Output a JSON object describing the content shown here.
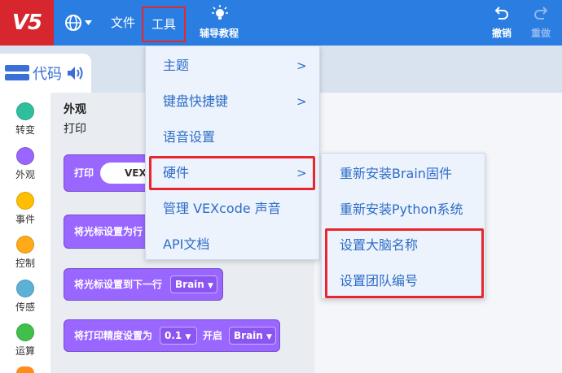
{
  "topbar": {
    "logo": "V5",
    "menu_files": "文件",
    "menu_tools": "工具",
    "tutorial_label": "辅导教程",
    "undo_label": "撤销",
    "redo_label": "重做",
    "bar_color": "#2a7de1",
    "logo_color": "#d7262e"
  },
  "tab": {
    "label": "代码"
  },
  "sidebar": {
    "categories": [
      {
        "label": "转变",
        "color": "#2fbf9f"
      },
      {
        "label": "外观",
        "color": "#9966ff"
      },
      {
        "label": "事件",
        "color": "#ffbf00"
      },
      {
        "label": "控制",
        "color": "#ffab19"
      },
      {
        "label": "传感",
        "color": "#5cb1d6"
      },
      {
        "label": "运算",
        "color": "#40bf4a"
      }
    ]
  },
  "palette": {
    "section_title": "外观",
    "subsection": "打印",
    "block_print": {
      "label": "打印",
      "value": "VEX"
    },
    "block_set_cursor_row": {
      "label": "将光标设置为行"
    },
    "block_next_row": {
      "label": "将光标设置到下一行",
      "dropdown": "Brain"
    },
    "block_precision": {
      "label": "将打印精度设置为",
      "value": "0.1",
      "label2": "开启",
      "dropdown": "Brain"
    }
  },
  "tools_menu": {
    "items": [
      {
        "label": "主题",
        "arrow": ">"
      },
      {
        "label": "键盘快捷键",
        "arrow": ">"
      },
      {
        "label": "语音设置",
        "arrow": ""
      },
      {
        "label": "硬件",
        "arrow": ">"
      },
      {
        "label": "管理 VEXcode 声音",
        "arrow": ""
      },
      {
        "label": "API文档",
        "arrow": ""
      }
    ]
  },
  "hardware_submenu": {
    "items": [
      {
        "label": "重新安装Brain固件"
      },
      {
        "label": "重新安装Python系统"
      },
      {
        "label": "设置大脑名称"
      },
      {
        "label": "设置团队编号"
      }
    ]
  },
  "highlight_color": "#e8262e"
}
